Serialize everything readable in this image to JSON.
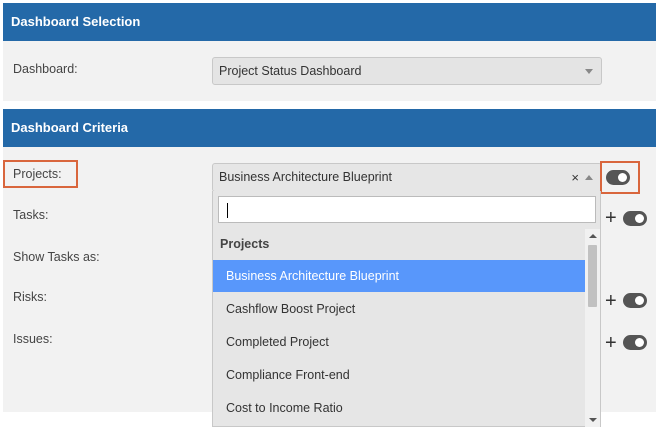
{
  "dashboard_selection": {
    "header": "Dashboard Selection",
    "dashboard_label": "Dashboard:",
    "dashboard_value": "Project Status Dashboard"
  },
  "dashboard_criteria": {
    "header": "Dashboard Criteria",
    "projects_label": "Projects:",
    "projects_value": "Business Architecture Blueprint",
    "clear_symbol": "×",
    "tasks_label": "Tasks:",
    "show_tasks_label": "Show Tasks as:",
    "risks_label": "Risks:",
    "issues_label": "Issues:",
    "plus_symbol": "+"
  },
  "dropdown": {
    "search_value": "",
    "group_label": "Projects",
    "options": [
      "Business Architecture Blueprint",
      "Cashflow Boost Project",
      "Completed Project",
      "Compliance Front-end",
      "Cost to Income Ratio"
    ],
    "selected_index": 0
  },
  "colors": {
    "header_bg": "#2469a8",
    "highlight_border": "#d9663d",
    "selected_option_bg": "#5897fb",
    "toggle_bg": "#555555"
  }
}
